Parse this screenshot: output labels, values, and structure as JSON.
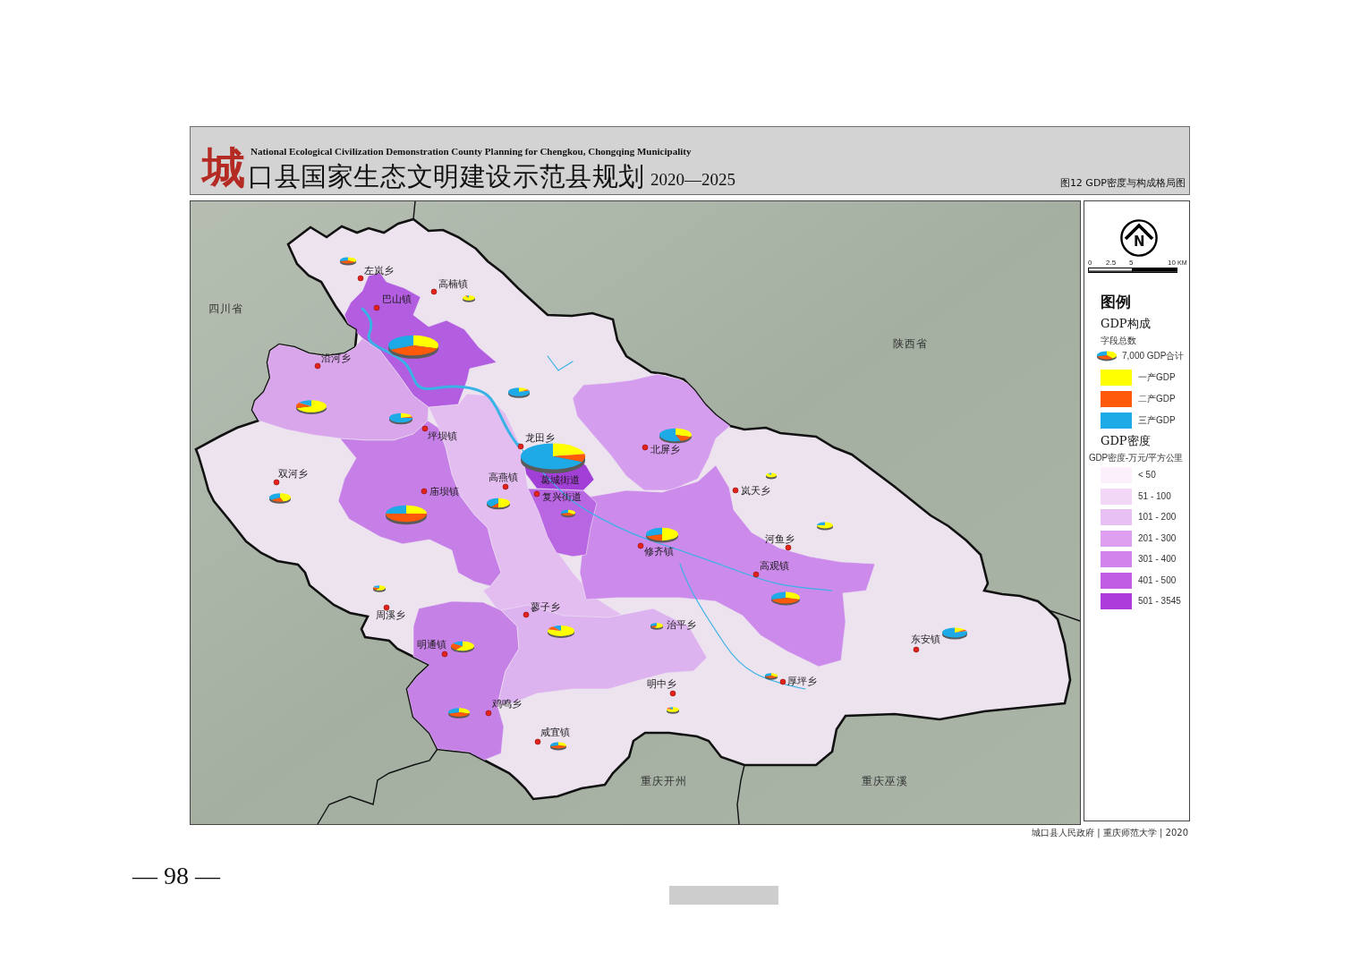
{
  "header": {
    "logo_char": "城",
    "subtitle_en": "National Ecological Civilization Demonstration County Planning for Chengkou, Chongqing Municipality",
    "title": "口县国家生态文明建设示范县规划",
    "years": "2020—2025",
    "figure_label": "图12 GDP密度与构成格局图"
  },
  "map": {
    "regions": [
      {
        "color": "#ece3ef"
      },
      {
        "color": "#e3bdf0"
      },
      {
        "color": "#d9a6ec"
      },
      {
        "color": "#c67fe7"
      },
      {
        "color": "#b35de1"
      },
      {
        "color": "#d49ded"
      },
      {
        "color": "#cc8aea"
      },
      {
        "color": "#b966e2"
      },
      {
        "color": "#a23fd6"
      },
      {
        "color": "#c681e7"
      },
      {
        "color": "#dcb2ef"
      }
    ],
    "neighbors": [
      {
        "name": "四川省"
      },
      {
        "name": "陕西省"
      },
      {
        "name": "重庆开州"
      },
      {
        "name": "重庆巫溪"
      }
    ],
    "towns": [
      {
        "name": "左岚乡"
      },
      {
        "name": "高楠镇"
      },
      {
        "name": "巴山镇"
      },
      {
        "name": "沿河乡"
      },
      {
        "name": "坪坝镇"
      },
      {
        "name": "龙田乡"
      },
      {
        "name": "北屏乡"
      },
      {
        "name": "双河乡"
      },
      {
        "name": "高燕镇"
      },
      {
        "name": "葛城街道"
      },
      {
        "name": "庙坝镇"
      },
      {
        "name": "复兴街道"
      },
      {
        "name": "岚天乡"
      },
      {
        "name": "河鱼乡"
      },
      {
        "name": "修齐镇"
      },
      {
        "name": "高观镇"
      },
      {
        "name": "周溪乡"
      },
      {
        "name": "蓼子乡"
      },
      {
        "name": "治平乡"
      },
      {
        "name": "明通镇"
      },
      {
        "name": "东安镇"
      },
      {
        "name": "明中乡"
      },
      {
        "name": "厚坪乡"
      },
      {
        "name": "鸡鸣乡"
      },
      {
        "name": "咸宜镇"
      }
    ]
  },
  "legend": {
    "north_letter": "N",
    "scale_labels": [
      "0",
      "2.5",
      "5",
      "10"
    ],
    "scale_unit": "KM",
    "title": "图例",
    "composition": {
      "heading": "GDP构成",
      "subheading": "字段总数",
      "total_label": "7,000 GDP合计",
      "items": [
        {
          "label": "一产GDP",
          "color": "#ffff00"
        },
        {
          "label": "二产GDP",
          "color": "#ff5a0a"
        },
        {
          "label": "三产GDP",
          "color": "#1eaae6"
        }
      ]
    },
    "density": {
      "heading": "GDP密度",
      "subheading": "GDP密度-万元/平方公里",
      "classes": [
        {
          "label": "< 50",
          "color": "#fbf0fb"
        },
        {
          "label": "51 - 100",
          "color": "#f2d8f6"
        },
        {
          "label": "101 - 200",
          "color": "#e8c0f4"
        },
        {
          "label": "201 - 300",
          "color": "#de9ff0"
        },
        {
          "label": "301 - 400",
          "color": "#d283ec"
        },
        {
          "label": "401 - 500",
          "color": "#c05de4"
        },
        {
          "label": "501 - 3545",
          "color": "#ad3bdc"
        }
      ]
    }
  },
  "credit": "城口县人民政府 | 重庆师范大学 | 2020",
  "page_number": "— 98 —"
}
